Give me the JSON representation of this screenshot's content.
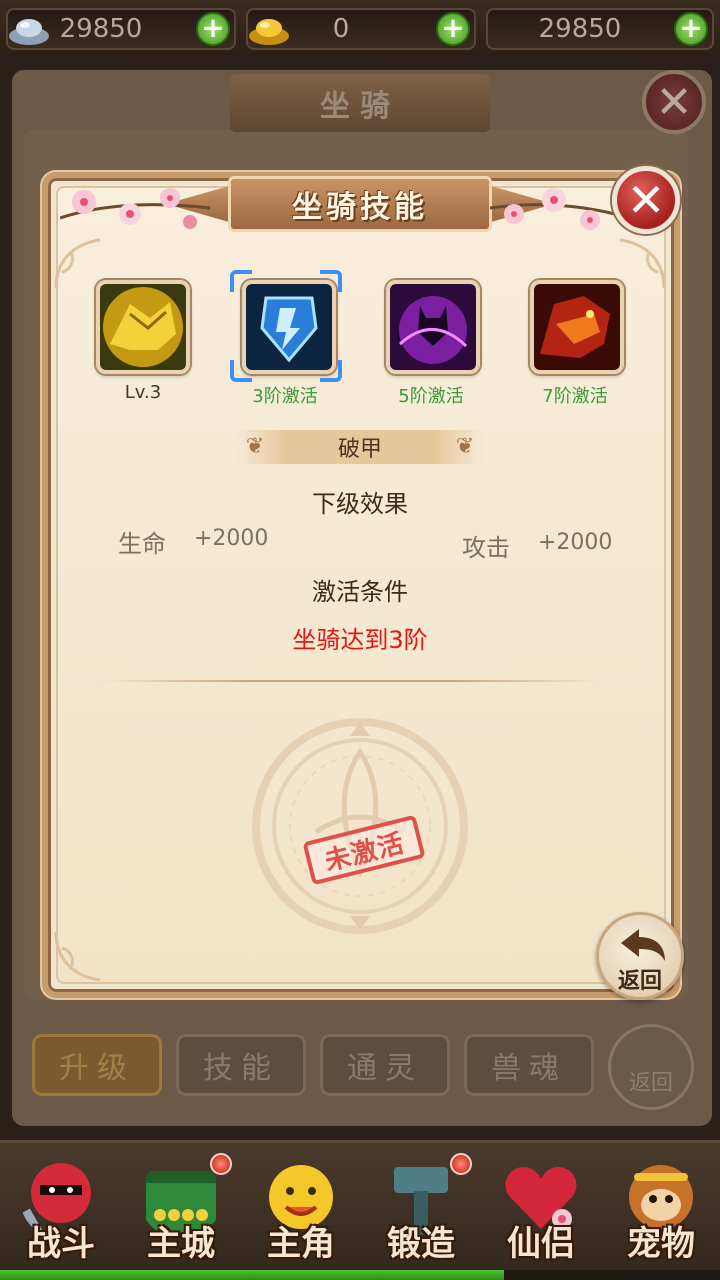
{
  "top_bar": {
    "silver": {
      "value": "29850"
    },
    "gold": {
      "value": "0"
    },
    "third": {
      "value": "29850"
    }
  },
  "background_panel": {
    "title": "坐骑",
    "tabs": [
      {
        "label": "升级",
        "active": true
      },
      {
        "label": "技能",
        "active": false
      },
      {
        "label": "通灵",
        "active": false
      },
      {
        "label": "兽魂",
        "active": false
      }
    ],
    "back_label": "返回"
  },
  "dialog": {
    "title": "坐骑技能",
    "skills": [
      {
        "label": "Lv.3",
        "icon": "golden-beast-skill-icon",
        "selected": false
      },
      {
        "label": "3阶激活",
        "icon": "blue-shield-skill-icon",
        "selected": true
      },
      {
        "label": "5阶激活",
        "icon": "purple-cat-skill-icon",
        "selected": false
      },
      {
        "label": "7阶激活",
        "icon": "red-dragon-skill-icon",
        "selected": false
      }
    ],
    "skill_name": "破甲",
    "next_effect_title": "下级效果",
    "stats": [
      {
        "name": "生命",
        "value": "+2000"
      },
      {
        "name": "攻击",
        "value": "+2000"
      }
    ],
    "condition_title": "激活条件",
    "condition_text": "坐骑达到3阶",
    "stamp_text": "未激活",
    "back_label": "返回"
  },
  "bottom_nav": [
    {
      "label": "战斗",
      "icon": "red-ninja-icon",
      "badge": false
    },
    {
      "label": "主城",
      "icon": "green-city-gate-icon",
      "badge": true
    },
    {
      "label": "主角",
      "icon": "yellow-character-icon",
      "badge": false
    },
    {
      "label": "锻造",
      "icon": "hammer-icon",
      "badge": true
    },
    {
      "label": "仙侣",
      "icon": "heart-flower-icon",
      "badge": false
    },
    {
      "label": "宠物",
      "icon": "monkey-pet-icon",
      "badge": false
    }
  ],
  "colors": {
    "dialog_bg": "#f3e6cf",
    "condition_red": "#e51818",
    "activation_green": "#3d9a3a",
    "select_blue": "#3d8ff6"
  },
  "progress": {
    "fraction": 0.7
  }
}
